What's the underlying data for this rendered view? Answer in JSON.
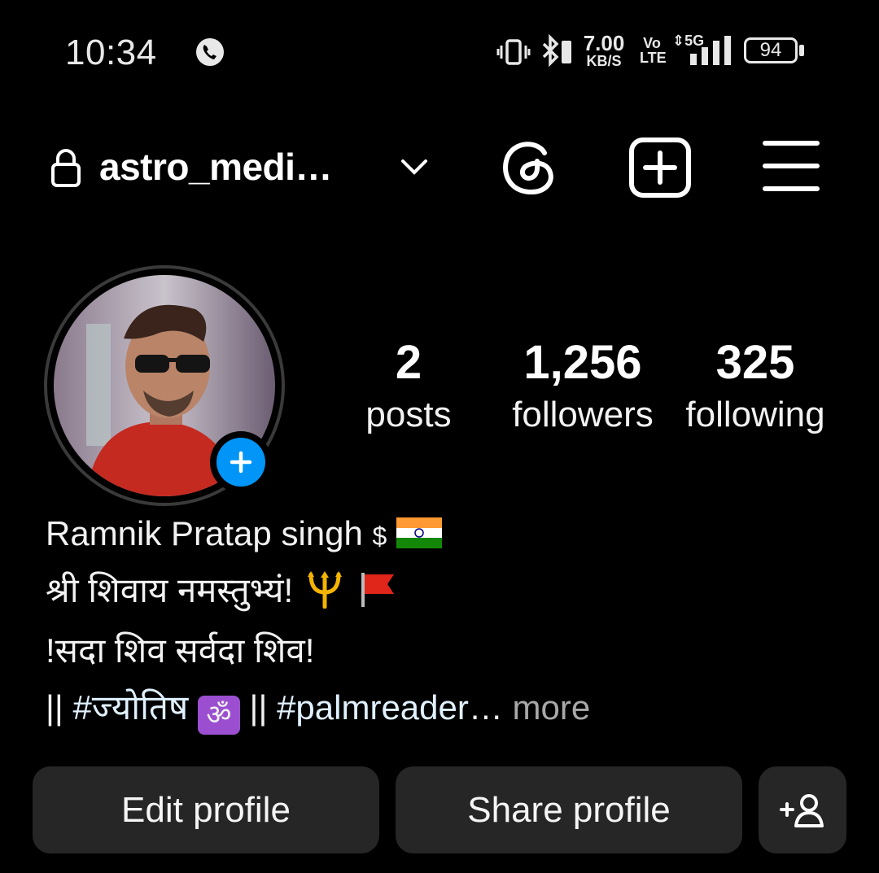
{
  "status_bar": {
    "time": "10:34",
    "net_speed_value": "7.00",
    "net_speed_unit": "KB/S",
    "volte_top": "Vo",
    "volte_bottom": "LTE",
    "network": "5G",
    "battery": "94"
  },
  "header": {
    "username": "astro_medi…",
    "icons": [
      "lock-icon",
      "chevron-down-icon",
      "threads-icon",
      "create-plus-icon",
      "menu-icon"
    ]
  },
  "profile": {
    "stats": [
      {
        "value": "2",
        "label": "posts"
      },
      {
        "value": "1,256",
        "label": "followers"
      },
      {
        "value": "325",
        "label": "following"
      }
    ]
  },
  "bio": {
    "name": "Ramnik Pratap singh",
    "name_symbol": "$",
    "line1": "श्री शिवाय नमस्तुभ्यं!",
    "line2": "!सदा शिव सर्वदा शिव!",
    "line3_prefix": "|| ",
    "line3_tag1": "#ज्योतिष",
    "line3_om": "ॐ",
    "line3_mid": " || ",
    "line3_tag2": "#palmreader",
    "line3_ellipsis": "…",
    "more": " more"
  },
  "actions": {
    "edit": "Edit profile",
    "share": "Share profile"
  },
  "colors": {
    "background": "#000000",
    "button": "#262626",
    "add_story": "#0095f6",
    "hashtag": "#e0f1ff"
  }
}
